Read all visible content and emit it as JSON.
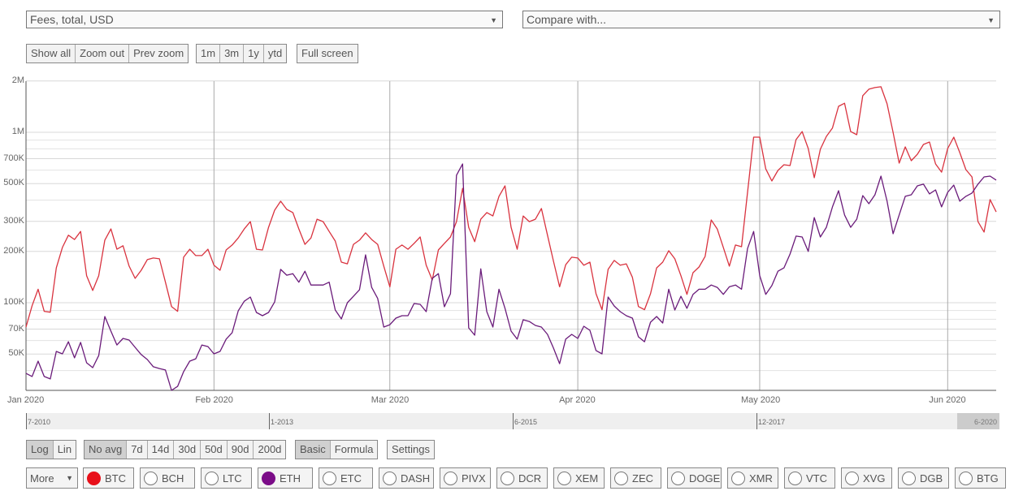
{
  "metric_select": {
    "value": "Fees, total, USD"
  },
  "compare_select": {
    "value": "Compare with..."
  },
  "zoom_buttons": [
    "Show all",
    "Zoom out",
    "Prev zoom"
  ],
  "range_buttons": [
    "1m",
    "3m",
    "1y",
    "ytd"
  ],
  "fullscreen_button": "Full screen",
  "scale_buttons": [
    {
      "label": "Log",
      "active": true
    },
    {
      "label": "Lin",
      "active": false
    }
  ],
  "avg_buttons": [
    {
      "label": "No avg",
      "active": true
    },
    {
      "label": "7d"
    },
    {
      "label": "14d"
    },
    {
      "label": "30d"
    },
    {
      "label": "50d"
    },
    {
      "label": "90d"
    },
    {
      "label": "200d"
    }
  ],
  "mode_buttons": [
    {
      "label": "Basic",
      "active": true
    },
    {
      "label": "Formula",
      "active": false
    }
  ],
  "settings_button": "Settings",
  "more_select": {
    "value": "More"
  },
  "coins": [
    {
      "label": "BTC",
      "selected": true,
      "color": "#e8101a"
    },
    {
      "label": "BCH",
      "selected": false
    },
    {
      "label": "LTC",
      "selected": false
    },
    {
      "label": "ETH",
      "selected": true,
      "color": "#7b0d88"
    },
    {
      "label": "ETC",
      "selected": false
    },
    {
      "label": "DASH",
      "selected": false
    },
    {
      "label": "PIVX",
      "selected": false
    },
    {
      "label": "DCR",
      "selected": false
    },
    {
      "label": "XEM",
      "selected": false
    },
    {
      "label": "ZEC",
      "selected": false
    },
    {
      "label": "DOGE",
      "selected": false
    },
    {
      "label": "XMR",
      "selected": false
    },
    {
      "label": "VTC",
      "selected": false
    },
    {
      "label": "XVG",
      "selected": false
    },
    {
      "label": "DGB",
      "selected": false
    },
    {
      "label": "BTG",
      "selected": false
    }
  ],
  "navigator": {
    "labels": [
      "7-2010",
      "1-2013",
      "6-2015",
      "12-2017",
      "6-2020"
    ]
  },
  "chart_data": {
    "type": "line",
    "title": "Fees, total, USD",
    "yscale": "log",
    "ylim": [
      30600,
      2000000
    ],
    "x_start": "2020-01-01",
    "x_end": "2020-06-09",
    "x_interval": "daily",
    "xticks": [
      "Jan 2020",
      "Feb 2020",
      "Mar 2020",
      "Apr 2020",
      "May 2020",
      "Jun 2020"
    ],
    "xtick_days": [
      0,
      31,
      60,
      91,
      121,
      152
    ],
    "yticks": [
      {
        "label": "2M",
        "value": 2000000
      },
      {
        "label": "1M",
        "value": 1000000
      },
      {
        "label": "700K",
        "value": 700000
      },
      {
        "label": "500K",
        "value": 500000
      },
      {
        "label": "300K",
        "value": 300000
      },
      {
        "label": "200K",
        "value": 200000
      },
      {
        "label": "100K",
        "value": 100000
      },
      {
        "label": "70K",
        "value": 70000
      },
      {
        "label": "50K",
        "value": 50000
      }
    ],
    "minor_gridlines": [
      900000,
      800000,
      600000,
      400000,
      90000,
      80000,
      60000,
      40000
    ],
    "grid": true,
    "units": "thousands USD",
    "series": [
      {
        "name": "BTC",
        "color": "#d9333f",
        "values": [
          72,
          96,
          120,
          89,
          88,
          160,
          211,
          249,
          235,
          262,
          144,
          118,
          144,
          233,
          271,
          206,
          216,
          164,
          139,
          155,
          179,
          183,
          181,
          132,
          95,
          89,
          185,
          206,
          189,
          189,
          206,
          166,
          155,
          204,
          218,
          240,
          271,
          299,
          206,
          204,
          277,
          349,
          394,
          353,
          338,
          271,
          220,
          240,
          309,
          299,
          262,
          230,
          173,
          169,
          220,
          233,
          257,
          235,
          220,
          164,
          124,
          206,
          218,
          206,
          223,
          243,
          166,
          136,
          204,
          223,
          243,
          299,
          469,
          277,
          228,
          309,
          338,
          323,
          421,
          485,
          277,
          206,
          323,
          299,
          309,
          357,
          249,
          175,
          124,
          167,
          185,
          183,
          166,
          173,
          113,
          91,
          157,
          177,
          166,
          169,
          141,
          95,
          91,
          113,
          160,
          173,
          202,
          181,
          144,
          112,
          150,
          162,
          187,
          306,
          271,
          211,
          164,
          218,
          213,
          444,
          936,
          936,
          610,
          518,
          597,
          645,
          638,
          906,
          1010,
          803,
          541,
          795,
          946,
          1060,
          1420,
          1480,
          1010,
          968,
          1640,
          1790,
          1830,
          1850,
          1470,
          1000,
          659,
          821,
          681,
          743,
          848,
          877,
          652,
          584,
          803,
          936,
          760,
          604,
          547,
          299,
          260,
          403,
          341
        ]
      },
      {
        "name": "ETH",
        "color": "#6a1b7a",
        "values": [
          38.5,
          36.9,
          45.4,
          36.9,
          35.7,
          51.8,
          50.1,
          59.0,
          47.5,
          58.5,
          44.4,
          41.6,
          49.0,
          83.0,
          68.1,
          56.5,
          61.7,
          60.4,
          54.7,
          49.6,
          46.4,
          42.1,
          41.1,
          40.3,
          30.6,
          32.3,
          39.4,
          45.4,
          46.9,
          56.5,
          55.3,
          50.1,
          51.8,
          61.1,
          66.7,
          89.6,
          102,
          108,
          87.7,
          83.9,
          87.7,
          101,
          157,
          145,
          148,
          132,
          153,
          127,
          127,
          127,
          132,
          90.6,
          80.3,
          100,
          109,
          119,
          191,
          123,
          106,
          72.0,
          74.3,
          81.2,
          83.9,
          83.9,
          98.9,
          97.8,
          88.6,
          139,
          148,
          94.7,
          113,
          560,
          652,
          71.2,
          64.5,
          158,
          88.6,
          72.0,
          120,
          92.7,
          68.1,
          61.1,
          79.4,
          77.6,
          73.6,
          72.0,
          65.2,
          54.1,
          43.9,
          61.1,
          65.2,
          61.7,
          72.8,
          68.9,
          52.4,
          50.1,
          108,
          95.7,
          88.6,
          83.9,
          81.2,
          63.1,
          59.0,
          76.9,
          83.0,
          76.0,
          120,
          90.6,
          109,
          92.7,
          112,
          120,
          120,
          127,
          123,
          112,
          124,
          127,
          120,
          208,
          262,
          144,
          112,
          126,
          153,
          160,
          193,
          246,
          243,
          200,
          316,
          243,
          277,
          365,
          454,
          327,
          277,
          309,
          425,
          381,
          430,
          553,
          394,
          254,
          327,
          421,
          430,
          485,
          496,
          435,
          459,
          365,
          444,
          490,
          394,
          421,
          440,
          496,
          547,
          553,
          524
        ]
      }
    ]
  }
}
